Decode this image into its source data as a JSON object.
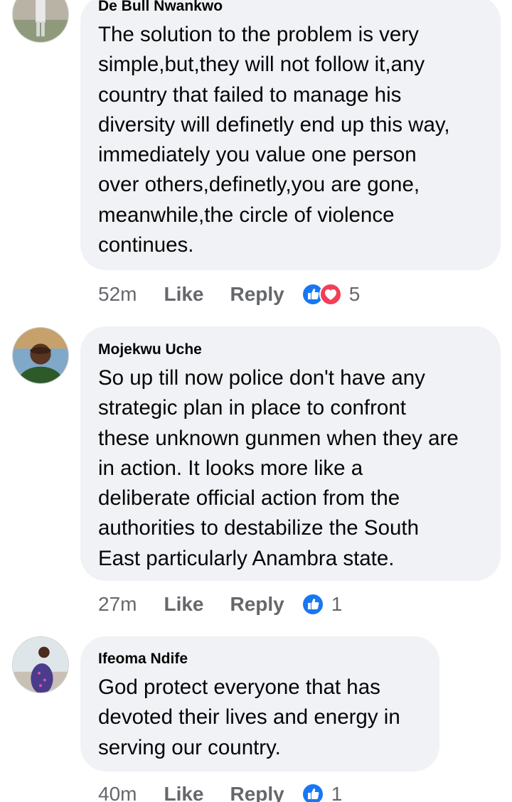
{
  "comments": [
    {
      "author": "De Bull Nwankwo",
      "text": "The solution to the problem is very\nsimple,but,they will not follow it,any\ncountry that failed to manage his\ndiversity will definetly end up this way,\nimmediately you value one person\nover others,definetly,you are gone,\nmeanwhile,the circle of violence\ncontinues.",
      "time": "52m",
      "like_label": "Like",
      "reply_label": "Reply",
      "reactions": [
        "like-icon",
        "love-icon"
      ],
      "reaction_count": "5"
    },
    {
      "author": "Mojekwu Uche",
      "text": "So up till now police don't have any\nstrategic plan in place to confront\nthese unknown gunmen when they are\nin action. It looks more like a\ndeliberate official action from the\nauthorities to destabilize the South\nEast particularly Anambra state.",
      "time": "27m",
      "like_label": "Like",
      "reply_label": "Reply",
      "reactions": [
        "like-icon"
      ],
      "reaction_count": "1"
    },
    {
      "author": "Ifeoma Ndife",
      "text": "God protect everyone that has\ndevoted their lives and energy in\nserving our country.",
      "time": "40m",
      "like_label": "Like",
      "reply_label": "Reply",
      "reactions": [
        "like-icon"
      ],
      "reaction_count": "1"
    }
  ],
  "colors": {
    "bubble": "#f0f2f5",
    "meta_text": "#65676b",
    "like_blue": "#1877f2",
    "love_red": "#f33e58"
  }
}
